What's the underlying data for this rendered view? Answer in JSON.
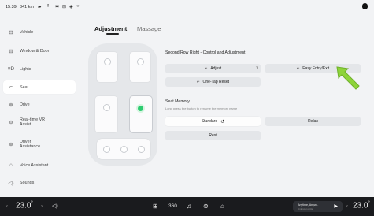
{
  "status_bar": {
    "time": "15:39",
    "range": "341 km",
    "icons": [
      "battery-icon",
      "signal-icon",
      "bluetooth-icon",
      "wifi-icon",
      "location-icon",
      "media-icon"
    ]
  },
  "sidebar": {
    "items": [
      {
        "label": "Vehicle",
        "icon": "car-icon"
      },
      {
        "label": "Window & Door",
        "icon": "door-icon"
      },
      {
        "label": "Lights",
        "icon": "light-icon"
      },
      {
        "label": "Seat",
        "icon": "seat-icon",
        "active": true
      },
      {
        "label": "Drive",
        "icon": "steering-icon"
      },
      {
        "label": "Real-time VR Assist",
        "icon": "vr-icon"
      },
      {
        "label": "Driver Assistance",
        "icon": "driver-assist-icon"
      },
      {
        "label": "Voice Assistant",
        "icon": "voice-icon"
      },
      {
        "label": "Sounds",
        "icon": "speaker-icon"
      }
    ]
  },
  "tabs": [
    {
      "label": "Adjustment",
      "active": true
    },
    {
      "label": "Massage",
      "active": false
    }
  ],
  "control": {
    "title": "Second Row Right - Control and Adjustment",
    "adjust_label": "Adjust",
    "easy_entry_label": "Easy Entry/Exit",
    "one_tap_reset_label": "One-Tap Reset"
  },
  "memory": {
    "title": "Seat Memory",
    "subtitle": "Long press the button to rename the memory name",
    "options": [
      "Standard",
      "Relax",
      "Rest"
    ]
  },
  "bottom_bar": {
    "driver_temp": "23.0",
    "passenger_temp": "23.0",
    "temp_unit": "°",
    "media_title": "Anytime, Anyw...",
    "media_subtitle": "Unknown Artist"
  },
  "colors": {
    "accent_green": "#2ecc71",
    "background": "#f2f3f5",
    "dock": "#1a1b1e"
  }
}
